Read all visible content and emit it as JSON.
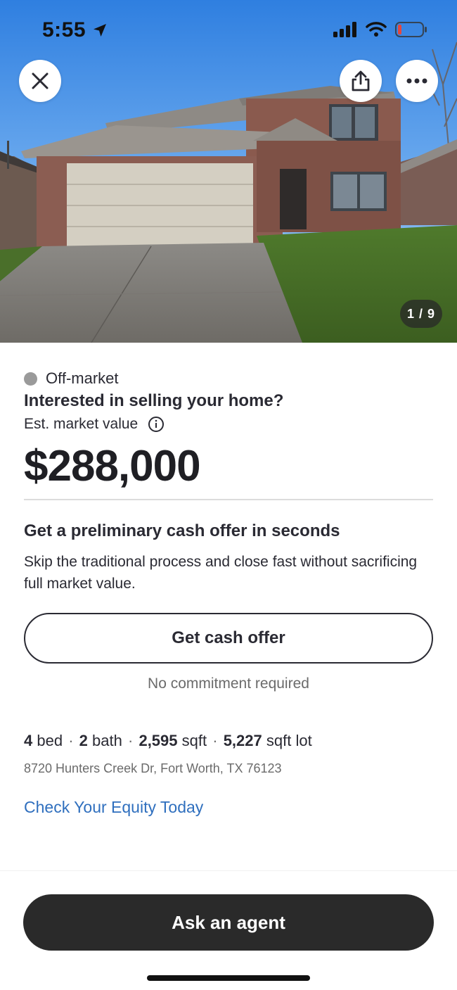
{
  "status_bar": {
    "time": "5:55",
    "icons": [
      "location-arrow-icon",
      "signal-icon",
      "wifi-icon",
      "battery-icon"
    ]
  },
  "hero": {
    "photo_counter": "1 / 9",
    "buttons": [
      "close-icon",
      "share-icon",
      "more-icon"
    ]
  },
  "listing": {
    "status": "Off-market",
    "selling_question": "Interested in selling your home?",
    "est_label": "Est. market value",
    "price": "$288,000"
  },
  "offer": {
    "title": "Get a preliminary cash offer in seconds",
    "description": "Skip the traditional process and close fast without sacrificing full market value.",
    "button_label": "Get cash offer",
    "note": "No commitment required"
  },
  "facts": {
    "beds": "4",
    "beds_label": "bed",
    "baths": "2",
    "baths_label": "bath",
    "sqft": "2,595",
    "sqft_label": "sqft",
    "lot": "5,227",
    "lot_label": "sqft lot",
    "address": "8720 Hunters Creek Dr, Fort Worth, TX 76123"
  },
  "equity_link": "Check Your Equity Today",
  "bottom": {
    "agent_button": "Ask an agent"
  },
  "colors": {
    "link": "#2f6fbe",
    "primary_dark": "#2a2a2a",
    "status_dot": "#9a9a9a",
    "battery_low": "#e5463d"
  }
}
